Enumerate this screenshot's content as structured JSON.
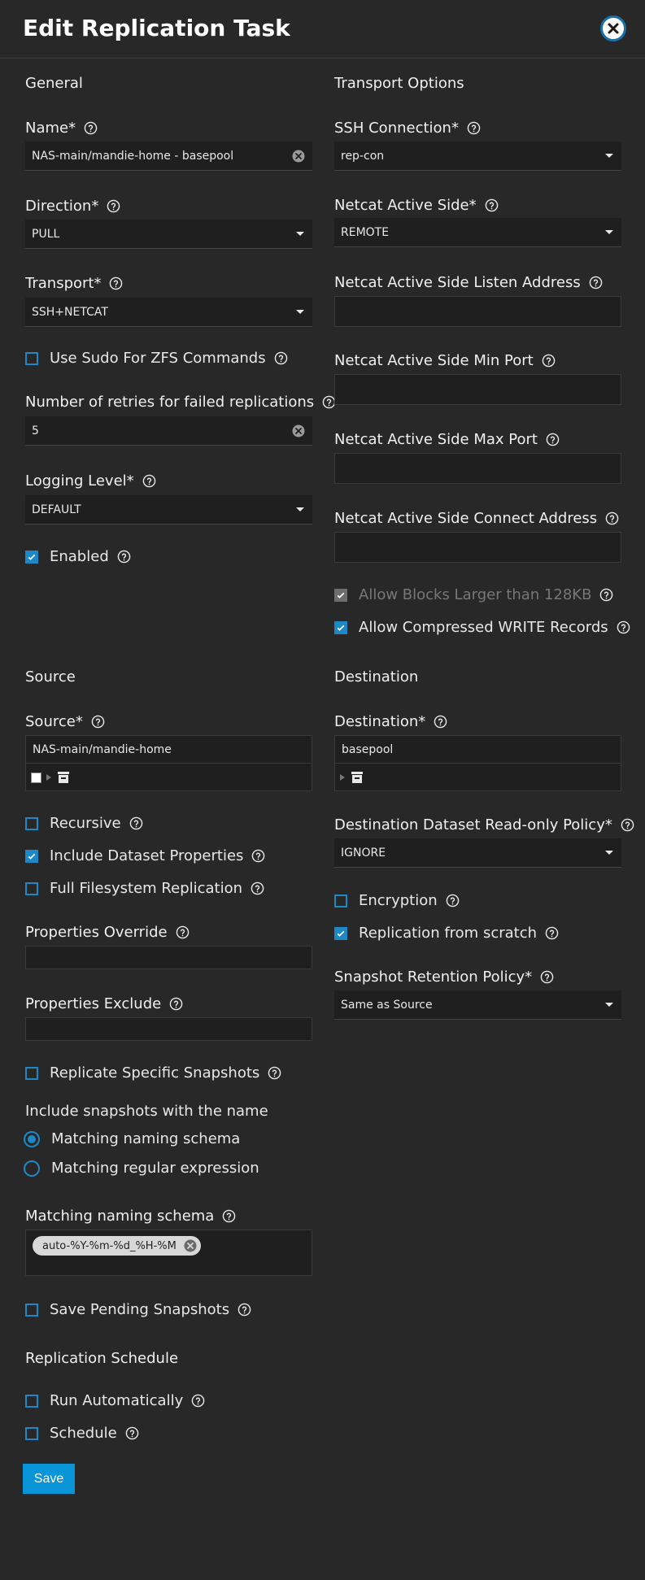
{
  "title": "Edit Replication Task",
  "sections": {
    "general": "General",
    "transport_options": "Transport Options",
    "source": "Source",
    "destination": "Destination",
    "replication_schedule": "Replication Schedule"
  },
  "general": {
    "name_label": "Name*",
    "name_value": "NAS-main/mandie-home - basepool",
    "direction_label": "Direction*",
    "direction_value": "PULL",
    "transport_label": "Transport*",
    "transport_value": "SSH+NETCAT",
    "sudo_label": "Use Sudo For ZFS Commands",
    "retries_label": "Number of retries for failed replications",
    "retries_value": "5",
    "logging_label": "Logging Level*",
    "logging_value": "DEFAULT",
    "enabled_label": "Enabled"
  },
  "transport": {
    "ssh_label": "SSH Connection*",
    "ssh_value": "rep-con",
    "netcat_side_label": "Netcat Active Side*",
    "netcat_side_value": "REMOTE",
    "listen_label": "Netcat Active Side Listen Address",
    "min_port_label": "Netcat Active Side Min Port",
    "max_port_label": "Netcat Active Side Max Port",
    "connect_label": "Netcat Active Side Connect Address",
    "large_blocks_label": "Allow Blocks Larger than 128KB",
    "compressed_label": "Allow Compressed WRITE Records"
  },
  "source": {
    "source_label": "Source*",
    "source_value": "NAS-main/mandie-home",
    "recursive_label": "Recursive",
    "include_props_label": "Include Dataset Properties",
    "full_fs_label": "Full Filesystem Replication",
    "props_override_label": "Properties Override",
    "props_exclude_label": "Properties Exclude",
    "replicate_specific_label": "Replicate Specific Snapshots",
    "include_snapshots_label": "Include snapshots with the name",
    "radio_schema_label": "Matching naming schema",
    "radio_regex_label": "Matching regular expression",
    "naming_schema_label": "Matching naming schema",
    "naming_schema_chip": "auto-%Y-%m-%d_%H-%M",
    "save_pending_label": "Save Pending Snapshots"
  },
  "destination": {
    "destination_label": "Destination*",
    "destination_value": "basepool",
    "readonly_label": "Destination Dataset Read-only Policy*",
    "readonly_value": "IGNORE",
    "encryption_label": "Encryption",
    "from_scratch_label": "Replication from scratch",
    "retention_label": "Snapshot Retention Policy*",
    "retention_value": "Same as Source"
  },
  "schedule": {
    "run_auto_label": "Run Automatically",
    "schedule_label": "Schedule"
  },
  "save_label": "Save",
  "colors": {
    "background": "#282828",
    "accent": "#1e88c7",
    "save": "#0a95d8"
  }
}
